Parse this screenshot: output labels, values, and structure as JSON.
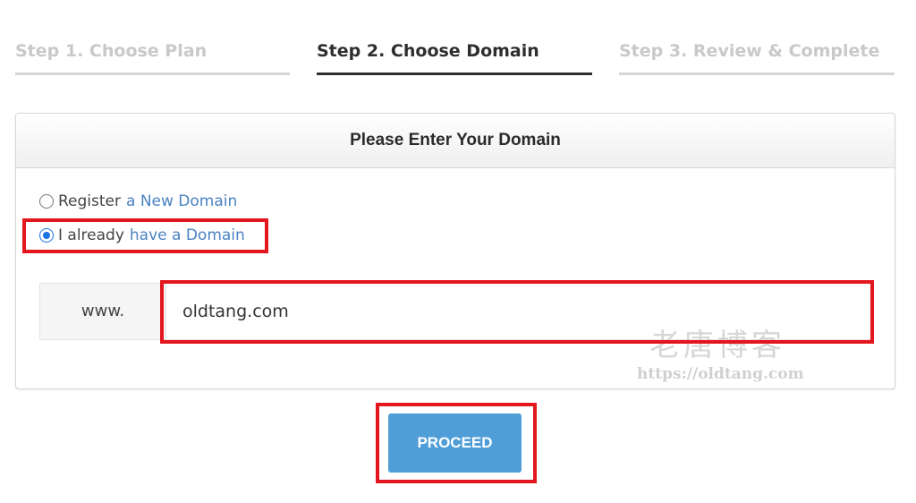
{
  "steps": [
    {
      "label": "Step 1. Choose Plan",
      "state": "inactive"
    },
    {
      "label": "Step 2. Choose Domain",
      "state": "active"
    },
    {
      "label": "Step 3. Review & Complete",
      "state": "inactive"
    }
  ],
  "panel": {
    "title": "Please Enter Your Domain",
    "options": [
      {
        "prefix": "Register",
        "link": "a New Domain",
        "checked": false
      },
      {
        "prefix": "I already",
        "link": "have a Domain",
        "checked": true
      }
    ],
    "domain": {
      "prefix": "www.",
      "value": "oldtang.com"
    }
  },
  "proceed_label": "PROCEED",
  "watermark": {
    "text": "老唐博客",
    "url": "https://oldtang.com"
  },
  "colors": {
    "accent": "#4f9ed8",
    "link": "#4a82c4",
    "highlight": "#e3161f"
  }
}
